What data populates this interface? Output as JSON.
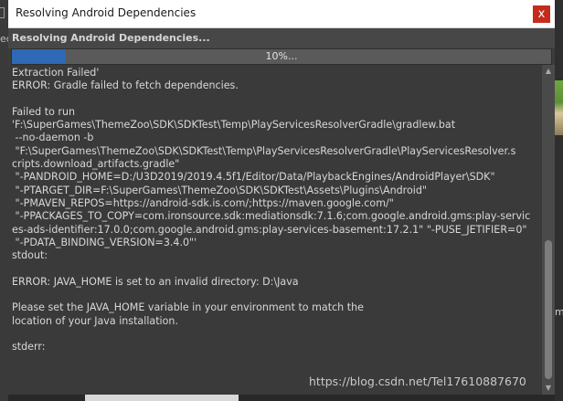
{
  "window": {
    "title": "Resolving Android Dependencies",
    "close_glyph": "x"
  },
  "header": {
    "label": "Resolving Android Dependencies..."
  },
  "progress": {
    "percent": 10,
    "label": "10%...",
    "fill_color": "#2f68b4"
  },
  "log": {
    "lines": [
      "Extraction Failed'",
      "ERROR: Gradle failed to fetch dependencies.",
      "",
      "Failed to run",
      "'F:\\SuperGames\\ThemeZoo\\SDK\\SDKTest\\Temp\\PlayServicesResolverGradle\\gradlew.bat",
      " --no-daemon -b",
      " \"F:\\SuperGames\\ThemeZoo\\SDK\\SDKTest\\Temp\\PlayServicesResolverGradle\\PlayServicesResolver.s",
      "cripts.download_artifacts.gradle\"",
      " \"-PANDROID_HOME=D:/U3D2019/2019.4.5f1/Editor/Data/PlaybackEngines/AndroidPlayer\\SDK\"",
      " \"-PTARGET_DIR=F:\\SuperGames\\ThemeZoo\\SDK\\SDKTest\\Assets\\Plugins\\Android\"",
      " \"-PMAVEN_REPOS=https://android-sdk.is.com/;https://maven.google.com/\"",
      " \"-PPACKAGES_TO_COPY=com.ironsource.sdk:mediationsdk:7.1.6;com.google.android.gms:play-servic",
      "es-ads-identifier:17.0.0;com.google.android.gms:play-services-basement:17.2.1\" \"-PUSE_JETIFIER=0\"",
      " \"-PDATA_BINDING_VERSION=3.4.0\"'",
      "stdout:",
      "",
      "ERROR: JAVA_HOME is set to an invalid directory: D:\\Java",
      "",
      "Please set the JAVA_HOME variable in your environment to match the",
      "location of your Java installation.",
      "",
      "stderr:"
    ]
  },
  "scrollbar": {
    "up_glyph": "▲",
    "down_glyph": "▼"
  },
  "background": {
    "left_fragment": "ed",
    "right_fragment": "m"
  },
  "watermark": "https://blog.csdn.net/Tel17610887670"
}
